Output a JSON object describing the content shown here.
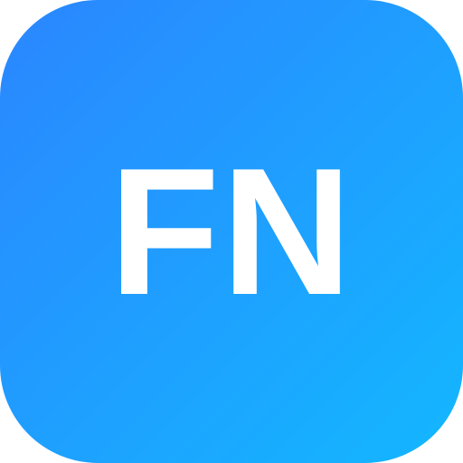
{
  "app_icon": {
    "label": "FN",
    "label_color": "#FFFFFF",
    "gradient_start_color": "#2B86FF",
    "gradient_end_color": "#13B7FF"
  }
}
